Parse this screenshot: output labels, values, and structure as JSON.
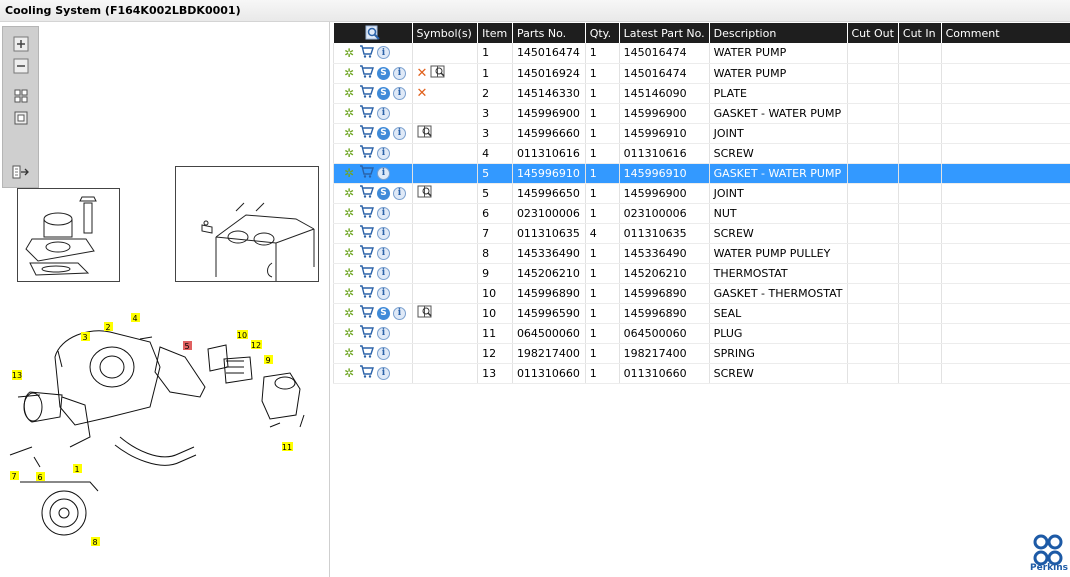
{
  "window": {
    "title": "Cooling System (F164K002LBDK0001)"
  },
  "brand": {
    "name": "Perkins",
    "color": "#1d5aa6"
  },
  "toolbox": {
    "buttons": [
      "zoom-in-icon",
      "zoom-out-icon",
      "fit-all-icon",
      "fit-window-icon",
      "export-icon"
    ]
  },
  "diagram": {
    "labels": [
      "1",
      "2",
      "3",
      "4",
      "5",
      "6",
      "7",
      "8",
      "9",
      "10",
      "11",
      "12",
      "13"
    ],
    "highlight_color": "#ffff00",
    "selected_label": "5",
    "selected_color": "#e06060"
  },
  "table": {
    "headers": {
      "search_icon": "search-icon",
      "symbols": "Symbol(s)",
      "item": "Item",
      "parts_no": "Parts No.",
      "qty": "Qty.",
      "latest_part_no": "Latest Part No.",
      "description": "Description",
      "cut_out": "Cut Out",
      "cut_in": "Cut In",
      "comment": "Comment"
    },
    "rows": [
      {
        "s": false,
        "sym": [],
        "item": "1",
        "part": "145016474",
        "qty": "1",
        "latest": "145016474",
        "desc": "WATER PUMP"
      },
      {
        "s": true,
        "sym": [
          "x",
          "book"
        ],
        "item": "1",
        "part": "145016924",
        "qty": "1",
        "latest": "145016474",
        "desc": "WATER PUMP"
      },
      {
        "s": true,
        "sym": [
          "x"
        ],
        "item": "2",
        "part": "145146330",
        "qty": "1",
        "latest": "145146090",
        "desc": "PLATE"
      },
      {
        "s": false,
        "sym": [],
        "item": "3",
        "part": "145996900",
        "qty": "1",
        "latest": "145996900",
        "desc": "GASKET - WATER PUMP"
      },
      {
        "s": true,
        "sym": [
          "book"
        ],
        "item": "3",
        "part": "145996660",
        "qty": "1",
        "latest": "145996910",
        "desc": "JOINT"
      },
      {
        "s": false,
        "sym": [],
        "item": "4",
        "part": "011310616",
        "qty": "1",
        "latest": "011310616",
        "desc": "SCREW"
      },
      {
        "s": false,
        "sym": [],
        "item": "5",
        "part": "145996910",
        "qty": "1",
        "latest": "145996910",
        "desc": "GASKET - WATER PUMP",
        "selected": true
      },
      {
        "s": true,
        "sym": [
          "book"
        ],
        "item": "5",
        "part": "145996650",
        "qty": "1",
        "latest": "145996900",
        "desc": "JOINT"
      },
      {
        "s": false,
        "sym": [],
        "item": "6",
        "part": "023100006",
        "qty": "1",
        "latest": "023100006",
        "desc": "NUT"
      },
      {
        "s": false,
        "sym": [],
        "item": "7",
        "part": "011310635",
        "qty": "4",
        "latest": "011310635",
        "desc": "SCREW"
      },
      {
        "s": false,
        "sym": [],
        "item": "8",
        "part": "145336490",
        "qty": "1",
        "latest": "145336490",
        "desc": "WATER PUMP PULLEY"
      },
      {
        "s": false,
        "sym": [],
        "item": "9",
        "part": "145206210",
        "qty": "1",
        "latest": "145206210",
        "desc": "THERMOSTAT"
      },
      {
        "s": false,
        "sym": [],
        "item": "10",
        "part": "145996890",
        "qty": "1",
        "latest": "145996890",
        "desc": "GASKET - THERMOSTAT"
      },
      {
        "s": true,
        "sym": [
          "book"
        ],
        "item": "10",
        "part": "145996590",
        "qty": "1",
        "latest": "145996890",
        "desc": "SEAL"
      },
      {
        "s": false,
        "sym": [],
        "item": "11",
        "part": "064500060",
        "qty": "1",
        "latest": "064500060",
        "desc": "PLUG"
      },
      {
        "s": false,
        "sym": [],
        "item": "12",
        "part": "198217400",
        "qty": "1",
        "latest": "198217400",
        "desc": "SPRING"
      },
      {
        "s": false,
        "sym": [],
        "item": "13",
        "part": "011310660",
        "qty": "1",
        "latest": "011310660",
        "desc": "SCREW"
      }
    ]
  }
}
